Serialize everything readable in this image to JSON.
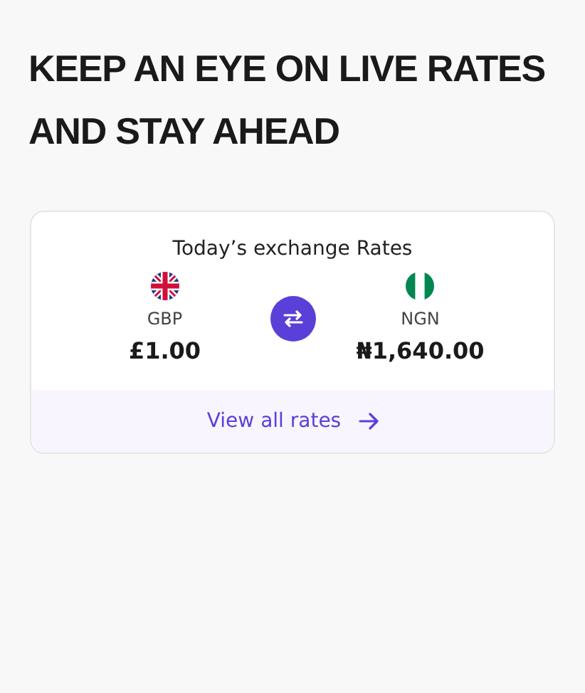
{
  "heading": "KEEP AN EYE ON LIVE RATES AND STAY AHEAD",
  "rates_card": {
    "title": "Today’s exchange Rates",
    "from": {
      "code": "GBP",
      "amount": "£1.00",
      "kind": "uk"
    },
    "to": {
      "code": "NGN",
      "amount": "₦1,640.00",
      "kind": "ng"
    },
    "link": "View all rates"
  }
}
